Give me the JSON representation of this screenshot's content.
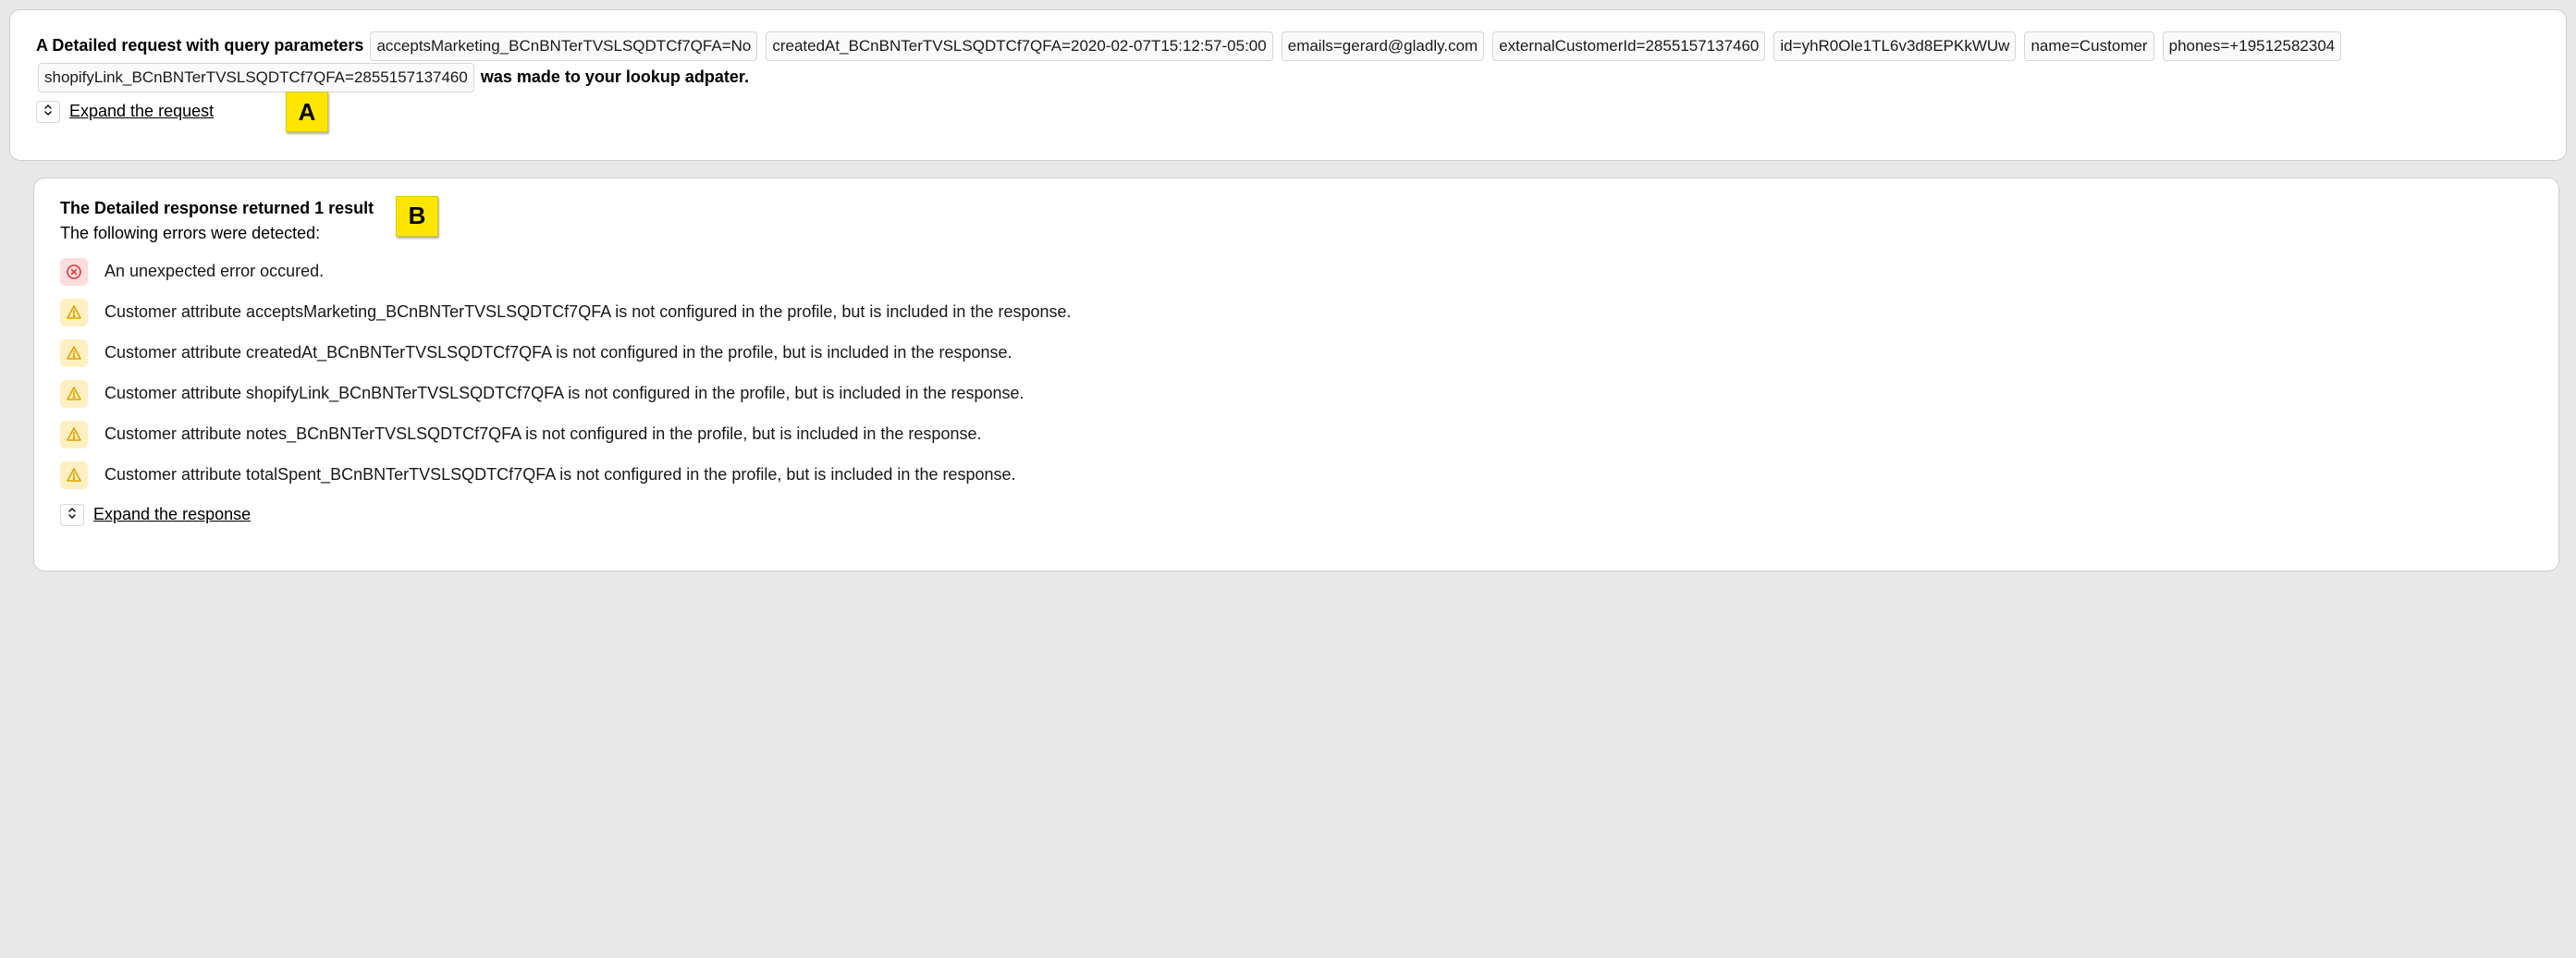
{
  "request_card": {
    "intro_bold": "A Detailed request with query parameters",
    "outro_bold": "was made to your lookup adpater.",
    "params": [
      "acceptsMarketing_BCnBNTerTVSLSQDTCf7QFA=No",
      "createdAt_BCnBNTerTVSLSQDTCf7QFA=2020-02-07T15:12:57-05:00",
      "emails=gerard@gladly.com",
      "externalCustomerId=2855157137460",
      "id=yhR0Ole1TL6v3d8EPKkWUw",
      "name=Customer",
      "phones=+19512582304",
      "shopifyLink_BCnBNTerTVSLSQDTCf7QFA=2855157137460"
    ],
    "expand_label": "Expand the request",
    "annotation": "A"
  },
  "response_card": {
    "title": "The Detailed response returned 1 result",
    "subtitle": "The following errors were detected:",
    "alerts": [
      {
        "type": "error",
        "text": "An unexpected error occured."
      },
      {
        "type": "warn",
        "text": "Customer attribute acceptsMarketing_BCnBNTerTVSLSQDTCf7QFA is not configured in the profile, but is included in the response."
      },
      {
        "type": "warn",
        "text": "Customer attribute createdAt_BCnBNTerTVSLSQDTCf7QFA is not configured in the profile, but is included in the response."
      },
      {
        "type": "warn",
        "text": "Customer attribute shopifyLink_BCnBNTerTVSLSQDTCf7QFA is not configured in the profile, but is included in the response."
      },
      {
        "type": "warn",
        "text": "Customer attribute notes_BCnBNTerTVSLSQDTCf7QFA is not configured in the profile, but is included in the response."
      },
      {
        "type": "warn",
        "text": "Customer attribute totalSpent_BCnBNTerTVSLSQDTCf7QFA is not configured in the profile, but is included in the response."
      }
    ],
    "expand_label": "Expand the response",
    "annotation": "B"
  }
}
